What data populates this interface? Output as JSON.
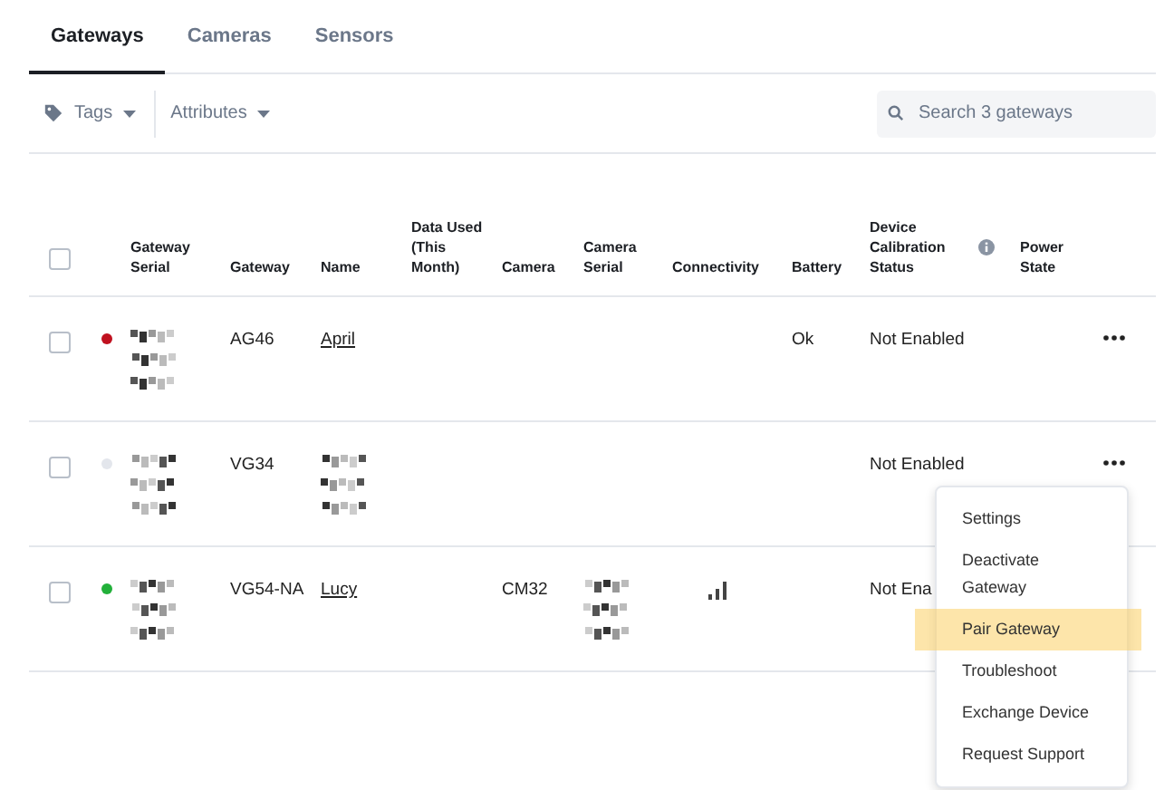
{
  "tabs": [
    {
      "label": "Gateways",
      "selected": true
    },
    {
      "label": "Cameras",
      "selected": false
    },
    {
      "label": "Sensors",
      "selected": false
    }
  ],
  "toolbar": {
    "filters": [
      "Tags",
      "Attributes"
    ],
    "search": {
      "placeholder": "Search 3 gateways"
    }
  },
  "table": {
    "select_all": {
      "checked": false
    },
    "columns": [
      "",
      "Gateway Serial",
      "Gateway",
      "Name",
      "Data Used (This Month)",
      "Camera",
      "Camera Serial",
      "Connectivity",
      "Battery",
      "Device Calibration Status",
      "Power State"
    ],
    "rows": [
      {
        "selected": false,
        "color": "#c0111f",
        "serial": {
          "kind": "pixelated"
        },
        "gateway": "AG46",
        "name": {
          "kind": "link",
          "text": "April"
        },
        "camera": "",
        "camera_serial": {
          "kind": "none"
        },
        "signal": false,
        "battery": "Ok",
        "calibration": "Not Enabled",
        "menu_button": true
      },
      {
        "selected": false,
        "color": "#e3e6ec",
        "serial": {
          "kind": "pixelated"
        },
        "gateway": "VG34",
        "name": {
          "kind": "pixelated_link"
        },
        "camera": "",
        "camera_serial": {
          "kind": "none"
        },
        "signal": false,
        "battery": "",
        "calibration": "Not Enabled",
        "menu_button": true
      },
      {
        "selected": false,
        "color": "#22b03a",
        "serial": {
          "kind": "pixelated"
        },
        "gateway": "VG54-NA",
        "name": {
          "kind": "link",
          "text": "Lucy"
        },
        "camera": "CM32",
        "camera_serial": {
          "kind": "pixelated"
        },
        "signal": true,
        "battery": "",
        "calibration": "Not Ena",
        "menu_button": false
      }
    ]
  },
  "menu": {
    "items": [
      {
        "label": "Settings",
        "selected": false
      },
      {
        "label": "Deactivate Gateway",
        "selected": false
      },
      {
        "label": "Pair Gateway",
        "selected": true
      },
      {
        "label": "Troubleshoot",
        "selected": false
      },
      {
        "label": "Exchange Device",
        "selected": false
      },
      {
        "label": "Request Support",
        "selected": false
      }
    ]
  }
}
